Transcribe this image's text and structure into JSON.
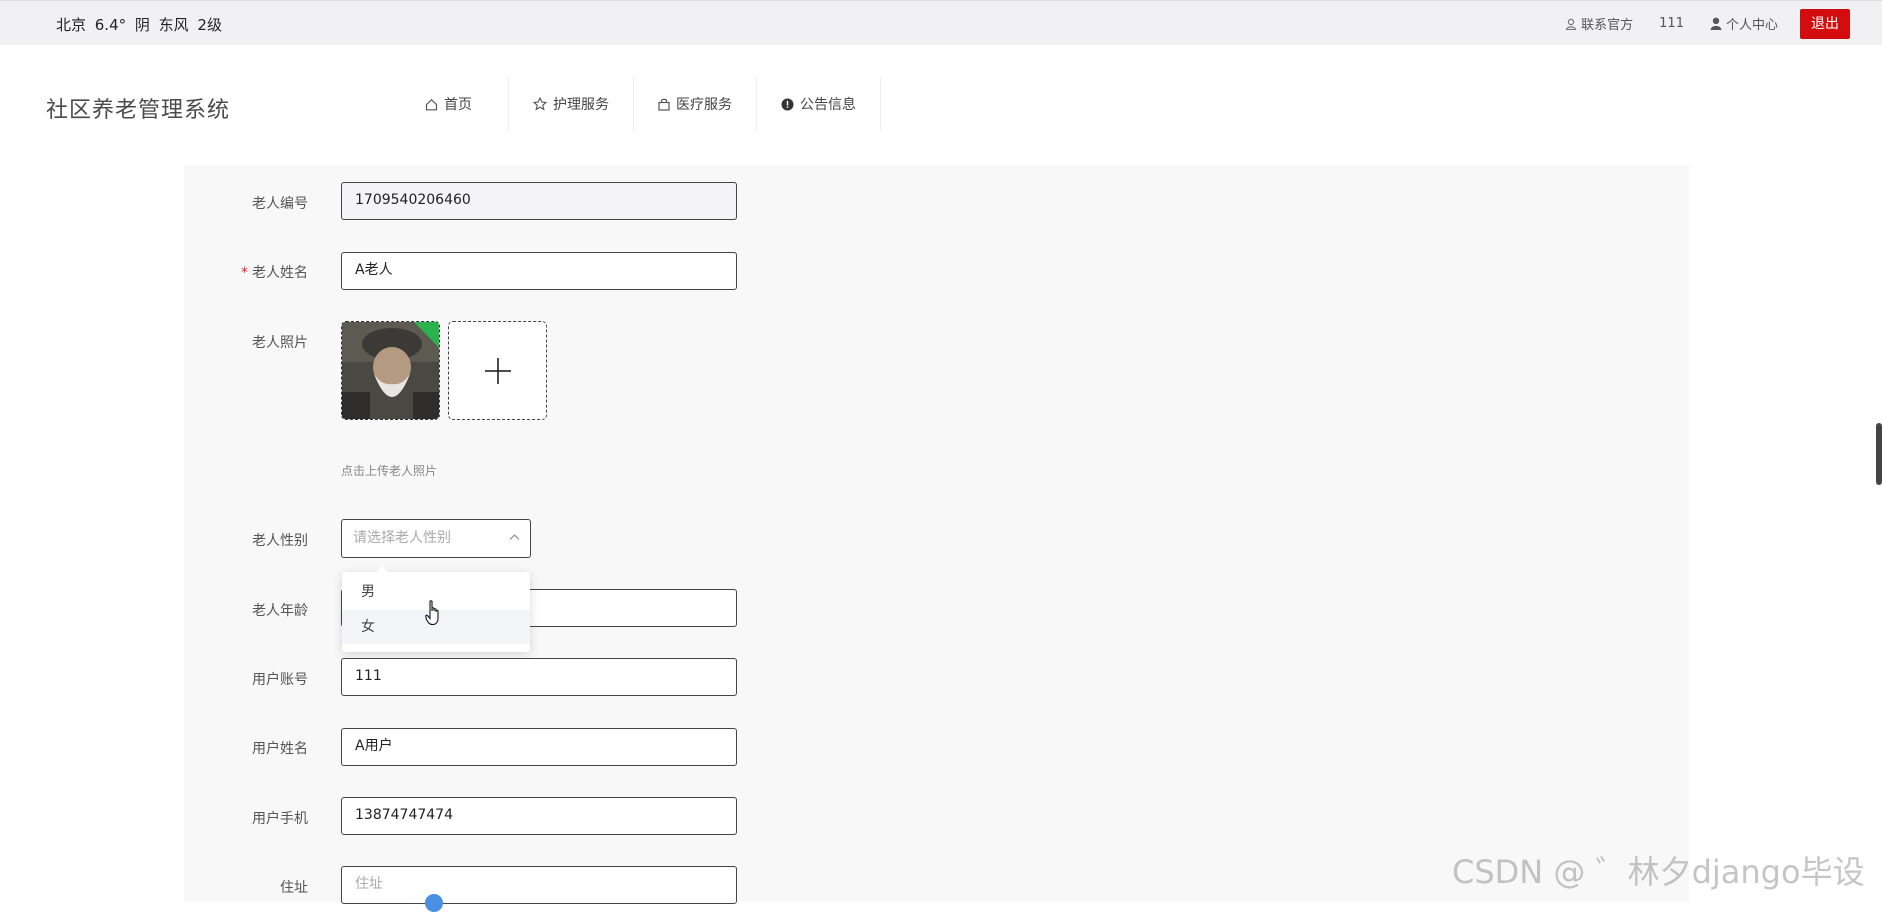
{
  "topbar": {
    "weather": "北京  6.4°  阴  东风  2级",
    "contact": "联系官方",
    "username": "111",
    "user_center": "个人中心",
    "logout": "退出"
  },
  "header": {
    "site_title": "社区养老管理系统",
    "nav": [
      "首页",
      "护理服务",
      "医疗服务",
      "公告信息"
    ]
  },
  "form": {
    "elder_id": {
      "label": "老人编号",
      "value": "1709540206460"
    },
    "elder_name": {
      "label": "老人姓名",
      "required_mark": "*",
      "value": "A老人"
    },
    "elder_photo": {
      "label": "老人照片",
      "hint": "点击上传老人照片"
    },
    "elder_gender": {
      "label": "老人性别",
      "placeholder": "请选择老人性别",
      "options": [
        "男",
        "女"
      ]
    },
    "elder_age": {
      "label": "老人年龄",
      "value": ""
    },
    "user_account": {
      "label": "用户账号",
      "value": "111"
    },
    "user_name": {
      "label": "用户姓名",
      "value": "A用户"
    },
    "user_phone": {
      "label": "用户手机",
      "value": "13874747474"
    },
    "address": {
      "label": "住址",
      "placeholder": "住址"
    }
  },
  "watermark": "CSDN @ ゛林夕django毕设",
  "colors": {
    "accent": "#d30d0d",
    "page_bg": "#f8f8f8"
  }
}
